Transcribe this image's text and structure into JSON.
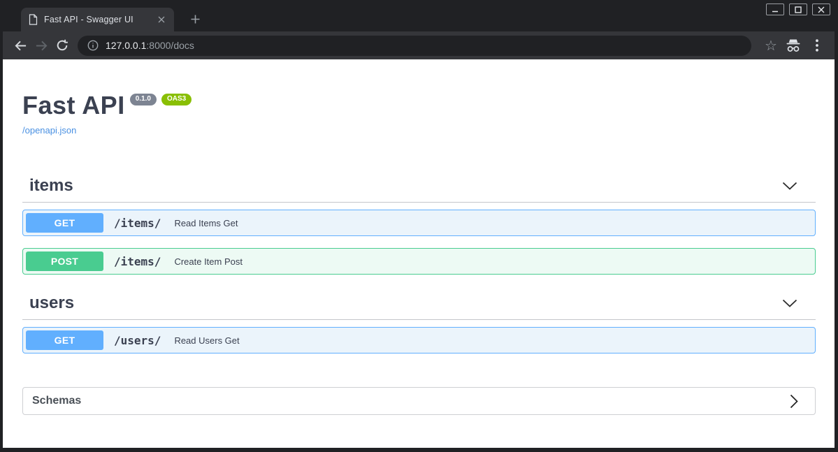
{
  "browser": {
    "tab": {
      "title": "Fast API - Swagger UI"
    },
    "address_bar": {
      "host": "127.0.0.1",
      "path": ":8000/docs"
    },
    "icons": {
      "star": "☆",
      "names": [
        "page-icon",
        "tab-close-icon",
        "new-tab-icon",
        "minimize-icon",
        "maximize-icon",
        "close-icon",
        "back-icon",
        "forward-icon",
        "reload-icon",
        "info-icon",
        "star-icon",
        "incognito-icon",
        "kebab-menu-icon",
        "chevron-down-icon",
        "chevron-right-icon"
      ]
    }
  },
  "api": {
    "title": "Fast API",
    "version_badge": "0.1.0",
    "spec_badge": "OAS3",
    "spec_link": "/openapi.json",
    "sections": [
      {
        "name": "items",
        "operations": [
          {
            "method": "GET",
            "path": "/items/",
            "summary": "Read Items Get"
          },
          {
            "method": "POST",
            "path": "/items/",
            "summary": "Create Item Post"
          }
        ]
      },
      {
        "name": "users",
        "operations": [
          {
            "method": "GET",
            "path": "/users/",
            "summary": "Read Users Get"
          }
        ]
      }
    ],
    "schemas_label": "Schemas"
  },
  "colors": {
    "get": "#61affe",
    "post": "#49cc90",
    "link": "#4990e2",
    "version_badge_bg": "#7d8492",
    "oas3_badge_bg": "#89bf04",
    "frame": "#202124",
    "toolbar": "#35363a",
    "heading_text": "#3b4151"
  }
}
